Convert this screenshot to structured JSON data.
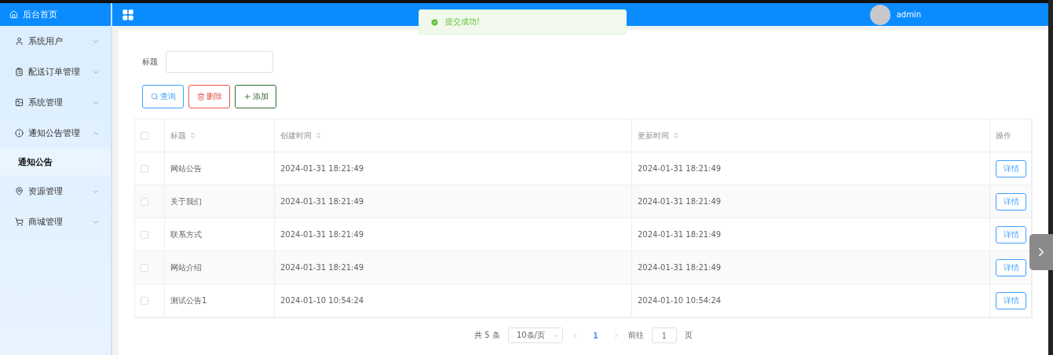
{
  "sidebar": {
    "home": "后台首页",
    "items": [
      {
        "label": "系统用户",
        "expanded": false
      },
      {
        "label": "配送订单管理",
        "expanded": false
      },
      {
        "label": "系统管理",
        "expanded": false
      },
      {
        "label": "通知公告管理",
        "expanded": true,
        "children": [
          {
            "label": "通知公告",
            "selected": true
          }
        ]
      },
      {
        "label": "资源管理",
        "expanded": false
      },
      {
        "label": "商城管理",
        "expanded": false
      }
    ]
  },
  "header": {
    "user": "admin"
  },
  "toast": {
    "text": "提交成功!"
  },
  "filter": {
    "label": "标题"
  },
  "buttons": [
    {
      "kind": "search",
      "label": "查询"
    },
    {
      "kind": "delete",
      "label": "删除"
    },
    {
      "kind": "add",
      "label": "添加"
    }
  ],
  "table": {
    "select_all": {
      "checked": false
    },
    "columns": [
      {
        "label": "标题",
        "sortable": true
      },
      {
        "label": "创建时间",
        "sortable": true
      },
      {
        "label": "更新时间",
        "sortable": true
      },
      {
        "label": "操作",
        "sortable": false
      }
    ],
    "rows": [
      {
        "checked": false,
        "cells": [
          "网站公告",
          "2024-01-31 18:21:49",
          "2024-01-31 18:21:49"
        ],
        "action": "详情"
      },
      {
        "checked": false,
        "cells": [
          "关于我们",
          "2024-01-31 18:21:49",
          "2024-01-31 18:21:49"
        ],
        "action": "详情"
      },
      {
        "checked": false,
        "cells": [
          "联系方式",
          "2024-01-31 18:21:49",
          "2024-01-31 18:21:49"
        ],
        "action": "详情"
      },
      {
        "checked": false,
        "cells": [
          "网站介绍",
          "2024-01-31 18:21:49",
          "2024-01-31 18:21:49"
        ],
        "action": "详情"
      },
      {
        "checked": false,
        "cells": [
          "测试公告1",
          "2024-01-10 10:54:24",
          "2024-01-10 10:54:24"
        ],
        "action": "详情"
      }
    ]
  },
  "pagination": {
    "total": "共 5 条",
    "page_size": "10条/页",
    "pages": [
      {
        "label": "1",
        "selected": true
      }
    ],
    "goto_label": "前往",
    "goto_value": "1",
    "goto_unit": "页"
  }
}
